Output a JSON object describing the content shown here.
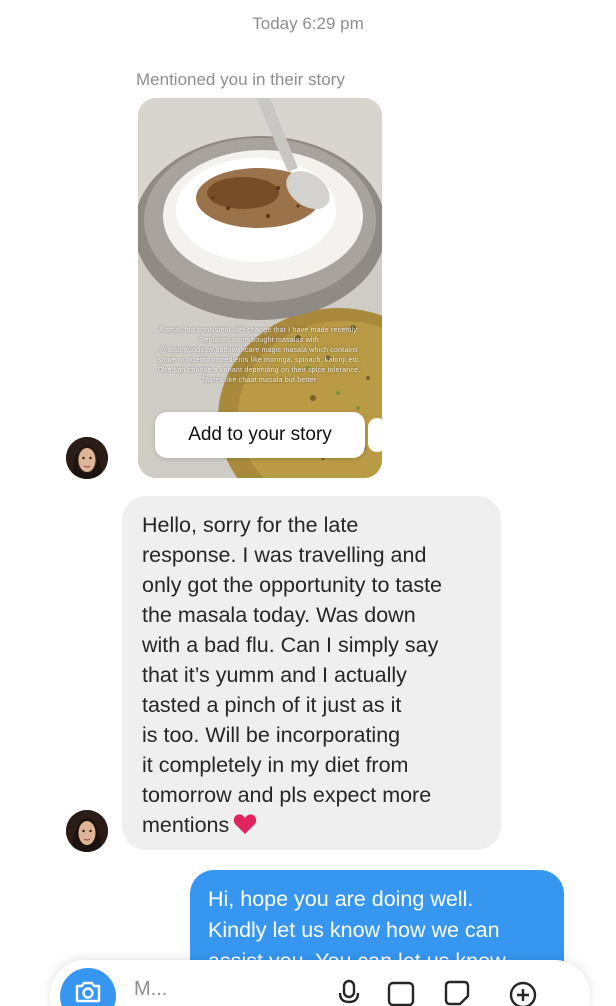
{
  "thread": {
    "timestamp": "Today 6:29 pm",
    "story_mention": {
      "caption": "Mentioned you in their story",
      "overlay_text": "A small but consistent diet change that I have made recently: Replaced store bought masalas with @superfoods.by.eatbiwithcare magic masala which contains some wonderful ingredients like moringa, spinach, kalonji etc. One can choose a variant depending on their spice tolerance. Tastes like chaat masala but better",
      "add_button_label": "Add to your story"
    },
    "incoming_message": {
      "lines": [
        "Hello, sorry for the late",
        "response. I was travelling and",
        "only got the opportunity to taste",
        "the masala today. Was down",
        "with a bad flu. Can I simply say",
        "that it’s yumm and I actually",
        "tasted a pinch of it just as it",
        "is too. Will be incorporating",
        "it completely in my diet from",
        "tomorrow and pls expect more",
        "mentions"
      ],
      "emoji": "red-heart"
    },
    "outgoing_message": {
      "lines": [
        "Hi, hope you are doing well.",
        "Kindly let us know how we can",
        "assist you. You can let us know"
      ]
    }
  },
  "composer": {
    "placeholder": "M...",
    "icons": [
      "camera-icon",
      "microphone-icon",
      "gallery-icon",
      "sticker-icon",
      "plus-icon"
    ]
  },
  "colors": {
    "outgoing_bubble": "#3797f0",
    "incoming_bubble": "#efefef",
    "meta_text": "#8e8e8e",
    "heart": "#e0245e"
  }
}
